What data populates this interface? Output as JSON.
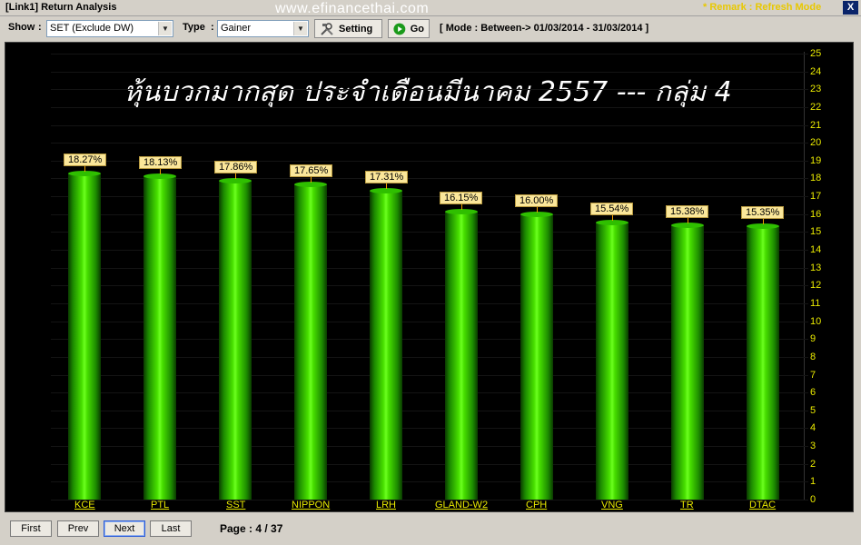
{
  "window": {
    "title": "[Link1] Return Analysis",
    "website": "www.efinancethai.com",
    "remark": "* Remark : Refresh Mode",
    "close_label": "X"
  },
  "toolbar": {
    "show_label": "Show",
    "show_value": "SET (Exclude DW)",
    "type_label": "Type",
    "type_value": "Gainer",
    "setting_label": "Setting",
    "go_label": "Go",
    "mode_text": "[ Mode : Between-> 01/03/2014 - 31/03/2014 ]"
  },
  "chart_data": {
    "type": "bar",
    "title": "หุ้นบวกมากสุด ประจำเดือนมีนาคม 2557 --- กลุ่ม 4",
    "categories": [
      "KCE",
      "PTL",
      "SST",
      "NIPPON",
      "LRH",
      "GLAND-W2",
      "CPH",
      "VNG",
      "TR",
      "DTAC"
    ],
    "values": [
      18.27,
      18.13,
      17.86,
      17.65,
      17.31,
      16.15,
      16.0,
      15.54,
      15.38,
      15.35
    ],
    "value_labels": [
      "18.27%",
      "18.13%",
      "17.86%",
      "17.65%",
      "17.31%",
      "16.15%",
      "16.00%",
      "15.54%",
      "15.38%",
      "15.35%"
    ],
    "ylim": [
      0,
      25
    ],
    "yticks": [
      0,
      1,
      2,
      3,
      4,
      5,
      6,
      7,
      8,
      9,
      10,
      11,
      12,
      13,
      14,
      15,
      16,
      17,
      18,
      19,
      20,
      21,
      22,
      23,
      24,
      25
    ],
    "yaxis_position": "right",
    "background": "#000000",
    "bar_color": "#3fd800",
    "tick_color": "#e8e800",
    "grid": true
  },
  "footer": {
    "first_label": "First",
    "prev_label": "Prev",
    "next_label": "Next",
    "last_label": "Last",
    "page_text": "Page : 4 / 37"
  }
}
